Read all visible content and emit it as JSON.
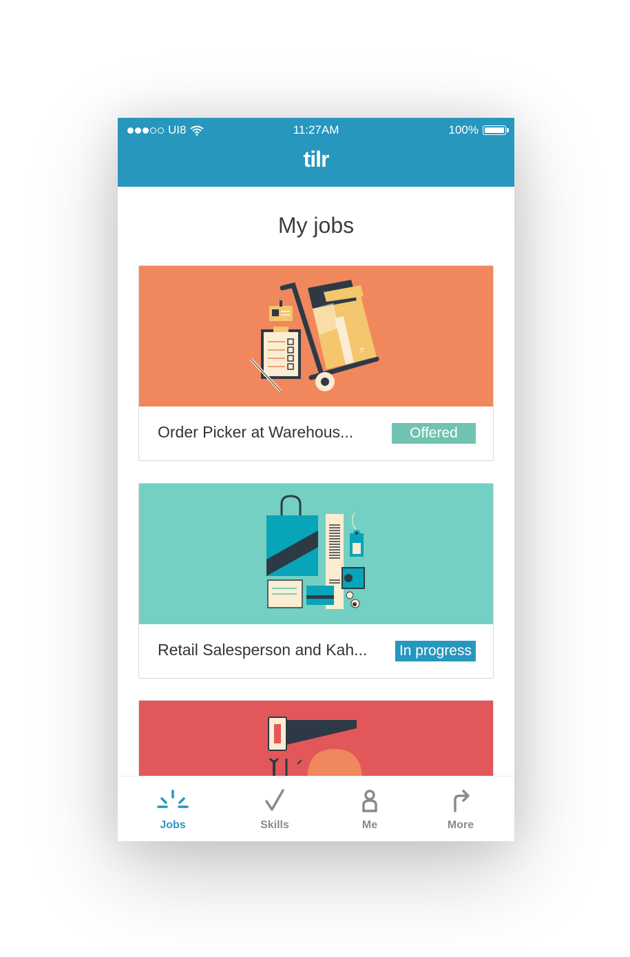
{
  "status_bar": {
    "carrier": "UI8",
    "time": "11:27AM",
    "battery": "100%"
  },
  "app": {
    "logo": "tilr"
  },
  "page": {
    "title": "My jobs"
  },
  "jobs": [
    {
      "title": "Order Picker at Warehous...",
      "status": "Offered",
      "color": "#f0875d"
    },
    {
      "title": "Retail Salesperson and Kah...",
      "status": "In progress",
      "color": "#74d0c2"
    },
    {
      "title": "",
      "status": "",
      "color": "#e2575a"
    }
  ],
  "tabs": [
    {
      "label": "Jobs",
      "icon": "jobs-icon",
      "active": true
    },
    {
      "label": "Skills",
      "icon": "check-icon",
      "active": false
    },
    {
      "label": "Me",
      "icon": "person-icon",
      "active": false
    },
    {
      "label": "More",
      "icon": "arrow-forward-icon",
      "active": false
    }
  ],
  "colors": {
    "brand": "#2797be",
    "offered": "#6fc3b0",
    "in_progress": "#2797be",
    "inactive_tab": "#8a8a8a"
  }
}
